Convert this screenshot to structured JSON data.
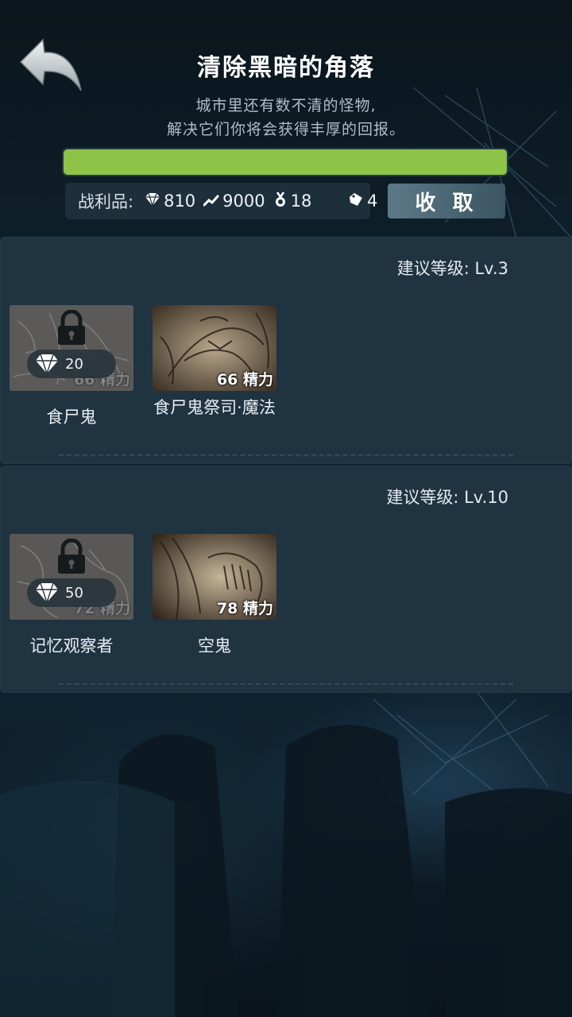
{
  "header": {
    "title": "清除黑暗的角落",
    "subtitle_line1": "城市里还有数不清的怪物,",
    "subtitle_line2": "解决它们你将会获得丰厚的回报。"
  },
  "progress": {
    "fraction": 1.0,
    "color": "#8dc346"
  },
  "loot": {
    "label": "战利品:",
    "items": [
      {
        "icon": "diamond-icon",
        "value": "810"
      },
      {
        "icon": "trend-icon",
        "value": "9000"
      },
      {
        "icon": "medal-icon",
        "value": "18"
      },
      {
        "icon": "tag-icon",
        "value": "4"
      }
    ],
    "collect_label": "收 取"
  },
  "sections": [
    {
      "level_text": "建议等级: Lv.3",
      "monsters": [
        {
          "name": "食尸鬼",
          "energy": "66 精力",
          "locked": true,
          "unlock_cost": "20"
        },
        {
          "name": "食尸鬼祭司·魔法",
          "energy": "66 精力",
          "locked": false
        }
      ]
    },
    {
      "level_text": "建议等级: Lv.10",
      "monsters": [
        {
          "name": "记忆观察者",
          "energy": "72 精力",
          "locked": true,
          "unlock_cost": "50"
        },
        {
          "name": "空鬼",
          "energy": "78 精力",
          "locked": false
        }
      ]
    }
  ],
  "colors": {
    "accent_green": "#8dc346",
    "panel": "#1f3341"
  }
}
